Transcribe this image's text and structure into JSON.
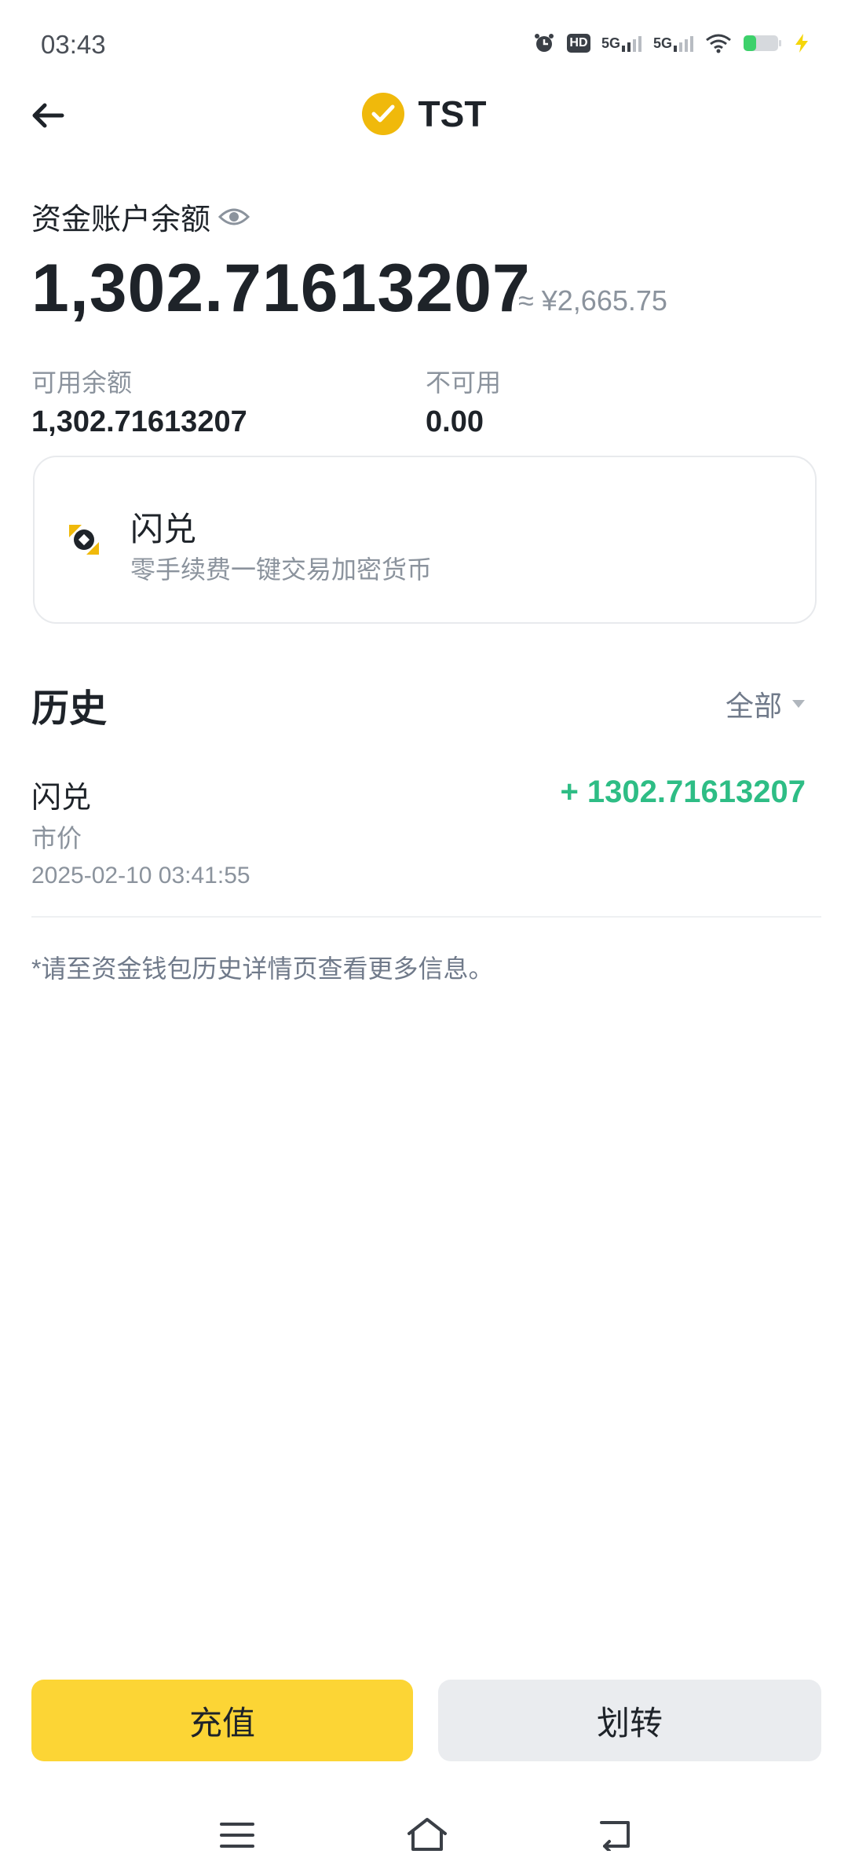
{
  "status_bar": {
    "time": "03:43",
    "icons": [
      "alarm-icon",
      "hd-icon",
      "signal-5g-icon",
      "signal-5g-icon",
      "wifi-icon",
      "battery-icon",
      "charging-icon"
    ],
    "net1": "5G",
    "net2": "5G",
    "hd": "HD"
  },
  "header": {
    "title": "TST",
    "back_icon": "arrow-left-icon",
    "coin_icon": "check-circle-icon"
  },
  "balance": {
    "label": "资金账户余额",
    "amount": "1,302.71613207",
    "approx": "≈ ¥2,665.75",
    "available_label": "可用余额",
    "available_value": "1,302.71613207",
    "unavailable_label": "不可用",
    "unavailable_value": "0.00"
  },
  "convert_card": {
    "title": "闪兑",
    "subtitle": "零手续费一键交易加密货币"
  },
  "history": {
    "title": "历史",
    "filter": "全部",
    "items": [
      {
        "title": "闪兑",
        "type": "市价",
        "date": "2025-02-10 03:41:55",
        "amount": "+ 1302.71613207"
      }
    ],
    "note": "*请至资金钱包历史详情页查看更多信息。"
  },
  "actions": {
    "deposit": "充值",
    "transfer": "划转"
  },
  "colors": {
    "accent": "#F0B90B",
    "button_primary": "#FCD535",
    "positive": "#2EBD85"
  }
}
